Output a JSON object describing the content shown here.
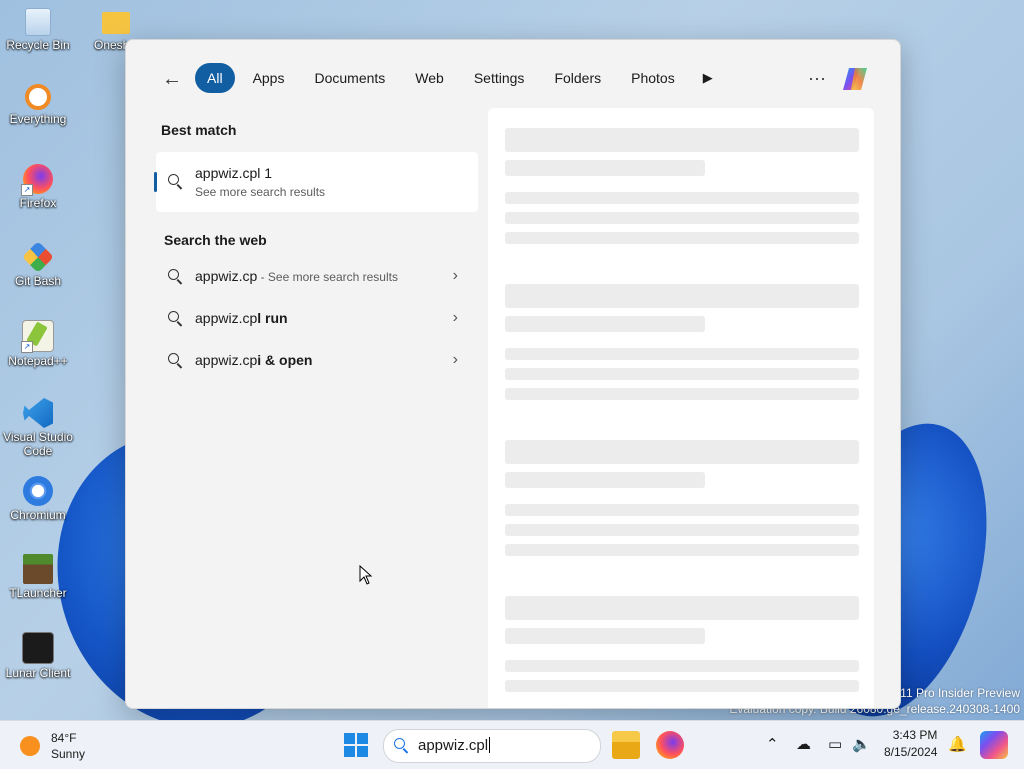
{
  "desktop": {
    "icons": [
      {
        "label": "Recycle Bin"
      },
      {
        "label": "Onesh"
      },
      {
        "label": "Everything"
      },
      {
        "label": "Firefox"
      },
      {
        "label": "Git Bash"
      },
      {
        "label": "Notepad++"
      },
      {
        "label": "Visual Studio Code"
      },
      {
        "label": "Chromium"
      },
      {
        "label": "TLauncher"
      },
      {
        "label": "Lunar Client"
      }
    ],
    "watermark_line1": "11 Pro Insider Preview",
    "watermark_line2": "Evaluation copy. Build 26080.ge_release.240308-1400"
  },
  "search_panel": {
    "filters": [
      "All",
      "Apps",
      "Documents",
      "Web",
      "Settings",
      "Folders",
      "Photos"
    ],
    "active_filter": "All",
    "best_match": {
      "heading": "Best match",
      "title": "appwiz.cpl 1",
      "subtitle": "See more search results"
    },
    "web": {
      "heading": "Search the web",
      "results": [
        {
          "prefix": "appwiz.cp",
          "suffix": "",
          "note": " - See more search results"
        },
        {
          "prefix": "appwiz.cp",
          "suffix": "l run",
          "note": ""
        },
        {
          "prefix": "appwiz.cp",
          "suffix": "i & open",
          "note": ""
        }
      ]
    }
  },
  "taskbar": {
    "weather_temp": "84°F",
    "weather_condition": "Sunny",
    "search_value": "appwiz.cpl",
    "time": "3:43 PM",
    "date": "8/15/2024"
  },
  "colors": {
    "accent": "#115ea3",
    "panel_bg": "#f3f3f3"
  }
}
